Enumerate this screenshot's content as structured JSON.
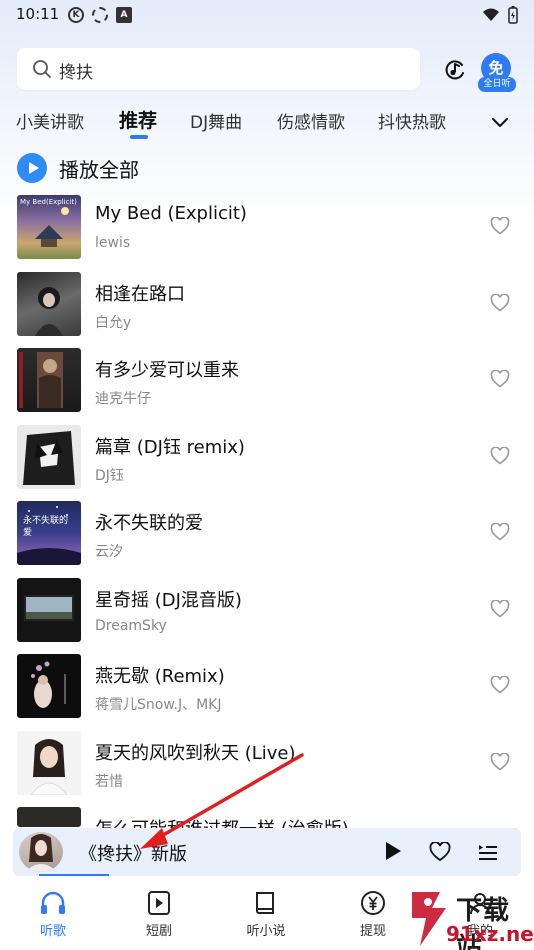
{
  "status_bar": {
    "time": "10:11"
  },
  "search": {
    "query": "搀扶"
  },
  "free_badge": {
    "char": "免",
    "label": "全日听"
  },
  "tabs": [
    {
      "label": "小美讲歌"
    },
    {
      "label": "推荐"
    },
    {
      "label": "DJ舞曲"
    },
    {
      "label": "伤感情歌"
    },
    {
      "label": "抖快热歌"
    }
  ],
  "play_all": {
    "label": "播放全部"
  },
  "songs": [
    {
      "title": "My Bed (Explicit)",
      "artist": "lewis",
      "cover_text": "My Bed(Explicit)"
    },
    {
      "title": "相逢在路口",
      "artist": "白允y"
    },
    {
      "title": "有多少爱可以重来",
      "artist": "迪克牛仔"
    },
    {
      "title": "篇章 (DJ钰 remix)",
      "artist": "DJ钰"
    },
    {
      "title": "永不失联的爱",
      "artist": "云汐",
      "cover_text": "永不失联的爱"
    },
    {
      "title": "星奇摇 (DJ混音版)",
      "artist": "DreamSky"
    },
    {
      "title": "燕无歇 (Remix)",
      "artist": "蒋雪儿Snow.J、MKJ"
    },
    {
      "title": "夏天的风吹到秋天 (Live)",
      "artist": "若惜"
    },
    {
      "title": "怎么可能和谁过都一样 (治愈版)",
      "artist": ""
    }
  ],
  "mini_player": {
    "title": "《搀扶》新版"
  },
  "bottom_nav": [
    {
      "label": "听歌"
    },
    {
      "label": "短剧"
    },
    {
      "label": "听小说"
    },
    {
      "label": "提现"
    },
    {
      "label": "我的"
    }
  ],
  "watermark": {
    "text": "下载站",
    "url": "91xz.net"
  },
  "colors": {
    "accent": "#2d7cf6",
    "arrow": "#e02020"
  }
}
